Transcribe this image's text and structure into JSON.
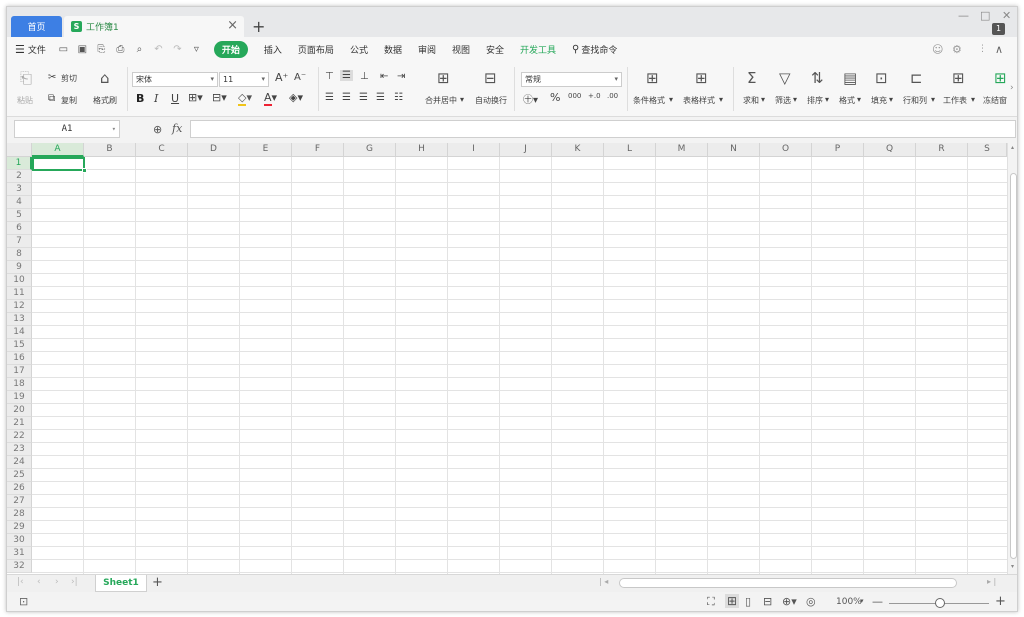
{
  "titlebar": {
    "home_tab": "首页",
    "doc_tab": "工作簿1",
    "doc_icon": "S",
    "close_glyph": "×",
    "add_glyph": "+",
    "min_glyph": "—",
    "max_glyph": "□",
    "winclose_glyph": "✕",
    "badge": "1"
  },
  "menubar": {
    "file": "文件",
    "tabs": [
      "开始",
      "插入",
      "页面布局",
      "公式",
      "数据",
      "审阅",
      "视图",
      "安全",
      "开发工具"
    ],
    "search": "查找命令"
  },
  "ribbon": {
    "paste": "粘贴",
    "cut": "剪切",
    "copy": "复制",
    "format_painter": "格式刷",
    "font_name": "宋体",
    "font_size": "11",
    "bold": "B",
    "italic": "I",
    "underline": "U",
    "merge": "合并居中",
    "wrap": "自动换行",
    "number_format": "常规",
    "percent": "%",
    "thousands": "000",
    "inc_decimal": "+.0",
    "dec_decimal": ".00",
    "cond_format": "条件格式",
    "table_style": "表格样式",
    "sum": "求和",
    "filter": "筛选",
    "sort": "排序",
    "format": "格式",
    "fill": "填充",
    "rowcol": "行和列",
    "sheet": "工作表",
    "freeze": "冻结窗"
  },
  "formula_bar": {
    "name_box": "A1",
    "fx": "fx",
    "value": ""
  },
  "grid": {
    "columns": [
      "A",
      "B",
      "C",
      "D",
      "E",
      "F",
      "G",
      "H",
      "I",
      "J",
      "K",
      "L",
      "M",
      "N",
      "O",
      "P",
      "Q",
      "R",
      "S"
    ],
    "rows": [
      "1",
      "2",
      "3",
      "4",
      "5",
      "6",
      "7",
      "8",
      "9",
      "10",
      "11",
      "12",
      "13",
      "14",
      "15",
      "16",
      "17",
      "18",
      "19",
      "20",
      "21",
      "22",
      "23",
      "24",
      "25",
      "26",
      "27",
      "28",
      "29",
      "30",
      "31",
      "32"
    ],
    "active_col": "A",
    "active_row": "1"
  },
  "sheetbar": {
    "sheets": [
      "Sheet1"
    ],
    "add": "+"
  },
  "statusbar": {
    "zoom": "100%",
    "zoom_minus": "—",
    "zoom_plus": "+"
  },
  "colors": {
    "accent": "#26a85a",
    "home_tab": "#3d7fe4"
  }
}
